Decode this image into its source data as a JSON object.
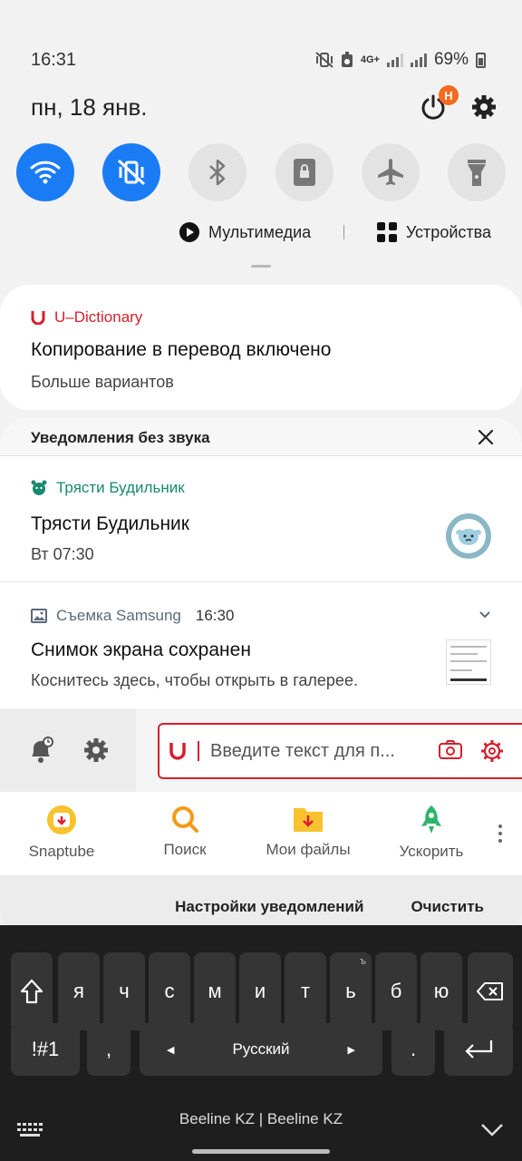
{
  "status_bar": {
    "time": "16:31",
    "network": "4G+",
    "battery": "69%"
  },
  "header": {
    "date": "пн, 18 янв.",
    "badge": "Н"
  },
  "quick_settings": {
    "tiles": [
      {
        "name": "wifi",
        "on": true
      },
      {
        "name": "sound",
        "on": true
      },
      {
        "name": "bluetooth",
        "on": false
      },
      {
        "name": "rotation-lock",
        "on": false
      },
      {
        "name": "airplane",
        "on": false
      },
      {
        "name": "flashlight",
        "on": false
      }
    ],
    "multimedia_label": "Мультимедиа",
    "devices_label": "Устройства"
  },
  "udict_notification": {
    "app": "U–Dictionary",
    "title": "Копирование в перевод включено",
    "subtitle": "Больше вариантов"
  },
  "silent_group": {
    "header": "Уведомления без звука",
    "alarm": {
      "app": "Трясти Будильник",
      "title": "Трясти Будильник",
      "time": "Вт 07:30"
    },
    "screenshot": {
      "app": "Съемка Samsung",
      "time": "16:30",
      "title": "Снимок экрана сохранен",
      "desc": "Коснитесь здесь, чтобы открыть в галерее."
    },
    "udict_bar": {
      "placeholder": "Введите текст для п..."
    },
    "shortcuts": [
      {
        "label": "Snaptube"
      },
      {
        "label": "Поиск"
      },
      {
        "label": "Мои файлы"
      },
      {
        "label": "Ускорить"
      }
    ],
    "footer": {
      "settings": "Настройки уведомлений",
      "clear": "Очистить"
    }
  },
  "keyboard": {
    "row1": [
      "я",
      "ч",
      "с",
      "м",
      "и",
      "т",
      "ь",
      "б",
      "ю"
    ],
    "hard_sign": "ъ",
    "symbols": "!#1",
    "comma": ",",
    "space": "Русский",
    "period": "."
  },
  "nav": {
    "carrier": "Beeline KZ | Beeline KZ"
  },
  "colors": {
    "accent": "#1a7cf5",
    "udict_red": "#d6202c",
    "alarm_green": "#17896f",
    "badge": "#f56b1f"
  }
}
